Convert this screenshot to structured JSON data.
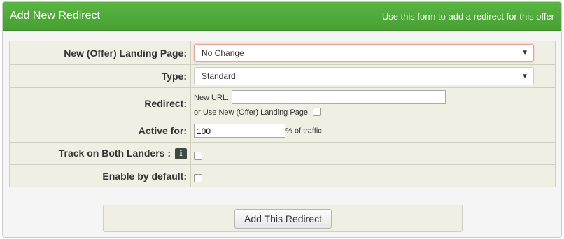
{
  "header": {
    "title": "Add New Redirect",
    "subtitle": "Use this form to add a redirect for this offer"
  },
  "form": {
    "landing_page": {
      "label": "New (Offer) Landing Page:",
      "selected": "No Change"
    },
    "type": {
      "label": "Type:",
      "selected": "Standard"
    },
    "redirect": {
      "label": "Redirect:",
      "new_url_label": "New URL:",
      "new_url_value": "",
      "use_landing_label": "or Use New (Offer) Landing Page:",
      "use_landing_checked": false
    },
    "active_for": {
      "label": "Active for:",
      "value": "100",
      "suffix": "% of traffic"
    },
    "track_both": {
      "label": "Track on Both Landers :",
      "info_icon": "i",
      "checked": false
    },
    "enable_default": {
      "label": "Enable by default:",
      "checked": false
    }
  },
  "actions": {
    "submit_label": "Add This Redirect"
  },
  "colors": {
    "header": "#4ea93a",
    "row_bg": "#efefe4",
    "focus_border": "#e8a39b"
  }
}
